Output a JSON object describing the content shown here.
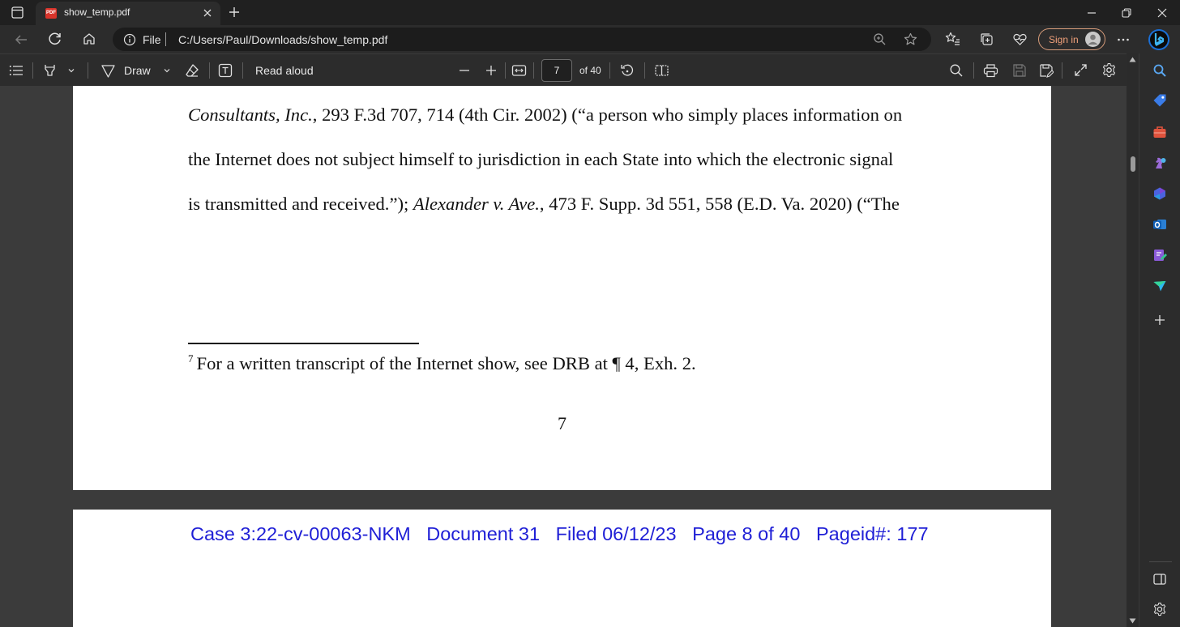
{
  "browser": {
    "tab_title": "show_temp.pdf",
    "tab_icon": "PDF",
    "url_scheme_label": "File",
    "url": "C:/Users/Paul/Downloads/show_temp.pdf",
    "sign_in_label": "Sign in"
  },
  "pdf_toolbar": {
    "draw_label": "Draw",
    "read_aloud_label": "Read aloud",
    "current_page": "7",
    "total_pages_label": "of 40"
  },
  "document": {
    "page7": {
      "line1_italic": "Consultants, Inc.",
      "line1_rest": ", 293 F.3d 707, 714 (4th Cir. 2002) (“a person who simply places information on",
      "line2": "the Internet does not subject himself to jurisdiction in each State into which the electronic signal",
      "line3_start": "is transmitted and received.”); ",
      "line3_italic": "Alexander v. Ave.",
      "line3_rest": ", 473 F. Supp. 3d 551, 558 (E.D. Va. 2020) (“The",
      "footnote_marker": "7",
      "footnote_text": "For a written transcript of the Internet show, see DRB at ¶ 4, Exh. 2.",
      "page_number": "7"
    },
    "page8": {
      "case_header": "Case 3:22-cv-00063-NKM   Document 31   Filed 06/12/23   Page 8 of 40   Pageid#: 177"
    }
  },
  "colors": {
    "case_header": "#1f1fd6",
    "sign_in_border": "#d79c7a",
    "pdf_badge": "#d9342b"
  }
}
